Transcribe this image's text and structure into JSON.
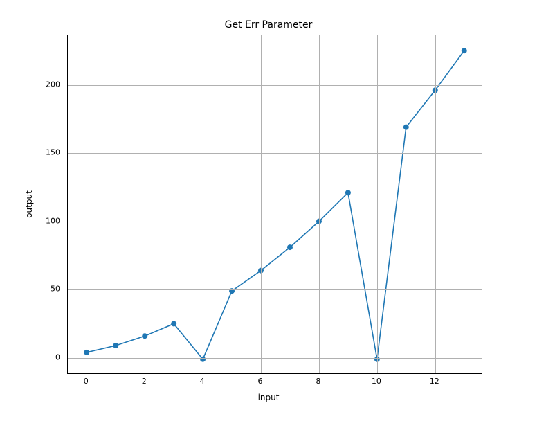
{
  "chart_data": {
    "type": "line",
    "title": "Get Err Parameter",
    "xlabel": "input",
    "ylabel": "output",
    "x": [
      0,
      1,
      2,
      3,
      4,
      5,
      6,
      7,
      8,
      9,
      10,
      11,
      12,
      13
    ],
    "y": [
      4,
      9,
      16,
      25,
      -1,
      49,
      64,
      81,
      100,
      121,
      -1,
      169,
      196,
      225
    ],
    "xticks": [
      0,
      2,
      4,
      6,
      8,
      10,
      12
    ],
    "yticks": [
      0,
      50,
      100,
      150,
      200
    ],
    "xlim": [
      -0.65,
      13.65
    ],
    "ylim": [
      -12.3,
      236.3
    ],
    "grid": true,
    "marker_color": "#1f77b4",
    "line_color": "#1f77b4"
  }
}
